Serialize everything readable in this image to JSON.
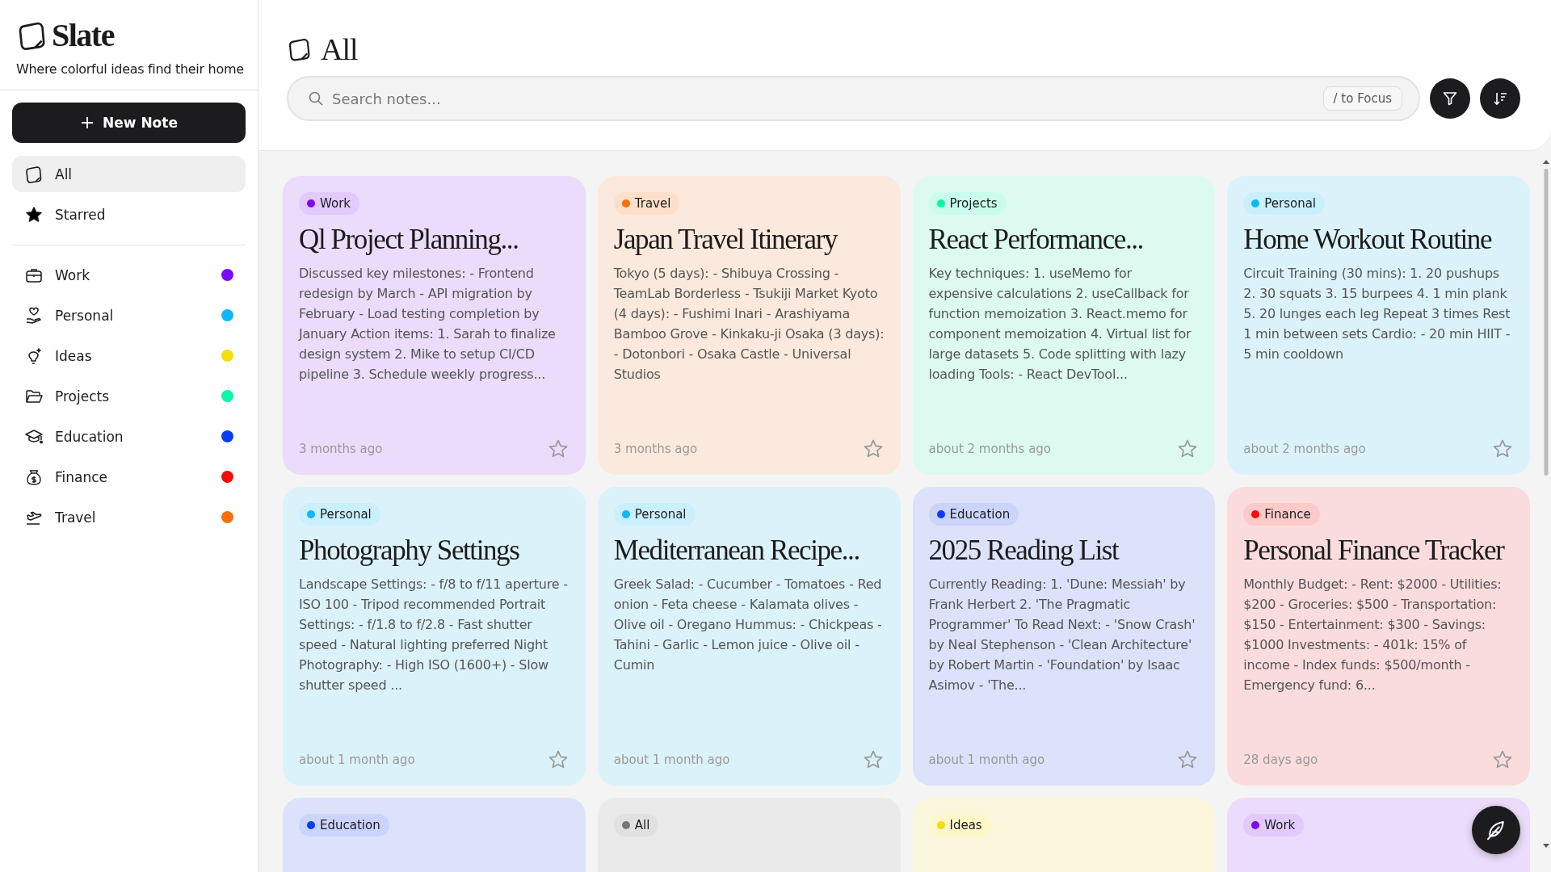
{
  "sidebar": {
    "logo": "Slate",
    "tagline": "Where colorful ideas find their home",
    "new_note_button": "New Note",
    "nav": [
      {
        "label": "All",
        "kind": "all",
        "selected": true
      },
      {
        "label": "Starred",
        "kind": "starred",
        "selected": false
      }
    ],
    "categories": [
      {
        "label": "Work",
        "kind": "work",
        "color": "#7a0cf5",
        "selected": false
      },
      {
        "label": "Personal",
        "kind": "personal",
        "color": "#0cb8f5",
        "selected": false
      },
      {
        "label": "Ideas",
        "kind": "ideas",
        "color": "#f5dc0c",
        "selected": false
      },
      {
        "label": "Projects",
        "kind": "projects",
        "color": "#0cf5a8",
        "selected": false
      },
      {
        "label": "Education",
        "kind": "education",
        "color": "#0c3cf5",
        "selected": false
      },
      {
        "label": "Finance",
        "kind": "finance",
        "color": "#f50c0c",
        "selected": false
      },
      {
        "label": "Travel",
        "kind": "travel",
        "color": "#f56f0c",
        "selected": false
      }
    ]
  },
  "header": {
    "title": "All",
    "search": {
      "placeholder": "Search notes...",
      "shortcut": "/ to Focus"
    }
  },
  "notes": [
    {
      "tag": "Work",
      "color": "#7a0cf5",
      "title": "Ql Project Planning...",
      "body": "Discussed key milestones: - Frontend redesign by March - API migration by February - Load testing completion by January Action items: 1. Sarah to finalize design system 2. Mike to setup CI/CD pipeline 3. Schedule weekly progress...",
      "date": "3 months ago",
      "starred": false
    },
    {
      "tag": "Travel",
      "color": "#f56f0c",
      "title": "Japan Travel Itinerary",
      "body": "Tokyo (5 days): - Shibuya Crossing - TeamLab Borderless - Tsukiji Market Kyoto (4 days): - Fushimi Inari - Arashiyama Bamboo Grove - Kinkaku-ji Osaka (3 days): - Dotonbori - Osaka Castle - Universal Studios",
      "date": "3 months ago",
      "starred": false
    },
    {
      "tag": "Projects",
      "color": "#0cf5a8",
      "title": "React Performance...",
      "body": "Key techniques: 1. useMemo for expensive calculations 2. useCallback for function memoization 3. React.memo for component memoization 4. Virtual list for large datasets 5. Code splitting with lazy loading Tools: - React DevTool...",
      "date": "about 2 months ago",
      "starred": false
    },
    {
      "tag": "Personal",
      "color": "#0cb8f5",
      "title": "Home Workout Routine",
      "body": "Circuit Training (30 mins): 1. 20 pushups 2. 30 squats 3. 15 burpees 4. 1 min plank 5. 20 lunges each leg Repeat 3 times Rest 1 min between sets Cardio: - 20 min HIIT - 5 min cooldown",
      "date": "about 2 months ago",
      "starred": false
    },
    {
      "tag": "Personal",
      "color": "#0cb8f5",
      "title": "Photography Settings",
      "body": "Landscape Settings: - f/8 to f/11 aperture - ISO 100 - Tripod recommended Portrait Settings: - f/1.8 to f/2.8 - Fast shutter speed - Natural lighting preferred Night Photography: - High ISO (1600+) - Slow shutter speed ...",
      "date": "about 1 month ago",
      "starred": false
    },
    {
      "tag": "Personal",
      "color": "#0cb8f5",
      "title": "Mediterranean Recipe...",
      "body": "Greek Salad: - Cucumber - Tomatoes - Red onion - Feta cheese - Kalamata olives - Olive oil - Oregano Hummus: - Chickpeas - Tahini - Garlic - Lemon juice - Olive oil - Cumin",
      "date": "about 1 month ago",
      "starred": false
    },
    {
      "tag": "Education",
      "color": "#0c3cf5",
      "title": "2025 Reading List",
      "body": "Currently Reading: 1. 'Dune: Messiah' by Frank Herbert 2. 'The Pragmatic Programmer' To Read Next: - 'Snow Crash' by Neal Stephenson - 'Clean Architecture' by Robert Martin - 'Foundation' by Isaac Asimov - 'The...",
      "date": "about 1 month ago",
      "starred": false
    },
    {
      "tag": "Finance",
      "color": "#f50c0c",
      "title": "Personal Finance Tracker",
      "body": "Monthly Budget: - Rent: $2000 - Utilities: $200 - Groceries: $500 - Transportation: $150 - Entertainment: $300 - Savings: $1000 Investments: - 401k: 15% of income - Index funds: $500/month - Emergency fund: 6...",
      "date": "28 days ago",
      "starred": false
    },
    {
      "tag": "Education",
      "color": "#0c3cf5"
    },
    {
      "tag": "All",
      "color": "#777777"
    },
    {
      "tag": "Ideas",
      "color": "#f5dc0c"
    },
    {
      "tag": "Work",
      "color": "#7a0cf5"
    }
  ]
}
